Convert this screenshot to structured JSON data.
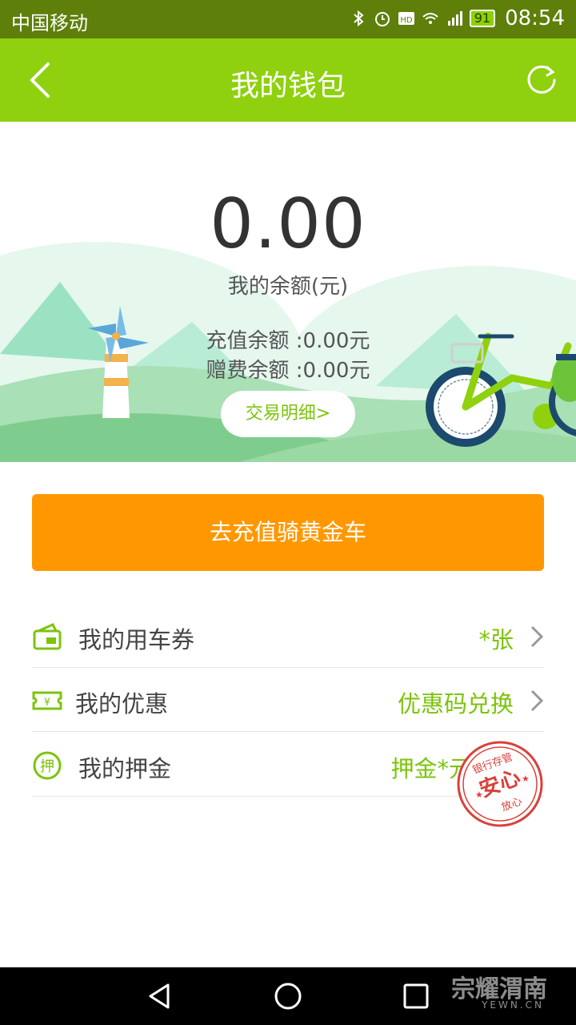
{
  "status_bar": {
    "carrier": "中国移动",
    "battery": "91",
    "time": "08:54",
    "network": "4G"
  },
  "header": {
    "title": "我的钱包",
    "back_icon": "back-chevron-icon",
    "refresh_icon": "refresh-icon"
  },
  "wallet": {
    "balance": "0.00",
    "balance_label": "我的余额(元)",
    "recharge_balance": "充值余额 :0.00元",
    "bonus_balance": "赠费余额 :0.00元",
    "detail_button": "交易明细>"
  },
  "recharge_button": "去充值骑黄金车",
  "menu": {
    "items": [
      {
        "label": "我的用车券",
        "value": "*张",
        "icon": "coupon-card-icon"
      },
      {
        "label": "我的优惠",
        "value": "优惠码兑换",
        "icon": "yen-ticket-icon"
      },
      {
        "label": "我的押金",
        "value": "押金*元",
        "icon": "deposit-icon",
        "icon_text": "押"
      }
    ]
  },
  "stamp": {
    "text_top": "银行存管",
    "text_center": "安心",
    "text_bottom": "放心"
  },
  "watermark": {
    "text": "宗耀渭南",
    "sub": "YEWN.CN"
  },
  "colors": {
    "accent_green": "#8fd10e",
    "orange": "#ff9800",
    "link_green": "#7cc40b",
    "stamp_red": "#d9403a"
  }
}
